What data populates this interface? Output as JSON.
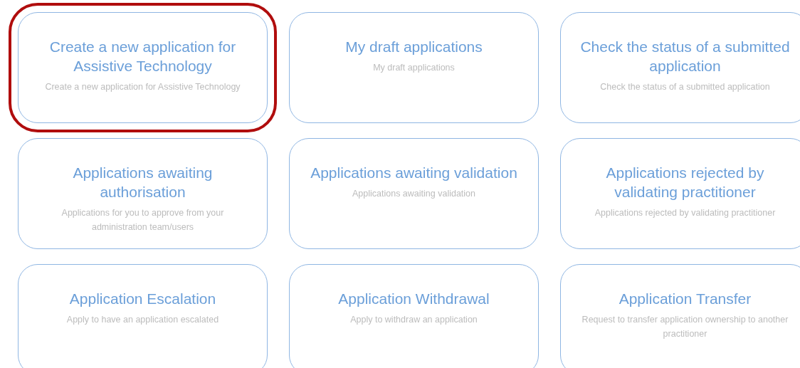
{
  "tiles": [
    {
      "title": "Create a new application for Assistive Technology",
      "description": "Create a new application for Assistive Technology",
      "selected": true
    },
    {
      "title": "My draft applications",
      "description": "My draft applications",
      "selected": false
    },
    {
      "title": "Check the status of a submitted application",
      "description": "Check the status of a submitted application",
      "selected": false
    },
    {
      "title": "Applications awaiting authorisation",
      "description": "Applications for you to approve from your administration team/users",
      "selected": false
    },
    {
      "title": "Applications awaiting validation",
      "description": "Applications awaiting validation",
      "selected": false
    },
    {
      "title": "Applications rejected by validating practitioner",
      "description": "Applications rejected by validating practitioner",
      "selected": false
    },
    {
      "title": "Application Escalation",
      "description": "Apply to have an application escalated",
      "selected": false
    },
    {
      "title": "Application Withdrawal",
      "description": "Apply to withdraw an application",
      "selected": false
    },
    {
      "title": "Application Transfer",
      "description": "Request to transfer application ownership to another practitioner",
      "selected": false
    }
  ]
}
